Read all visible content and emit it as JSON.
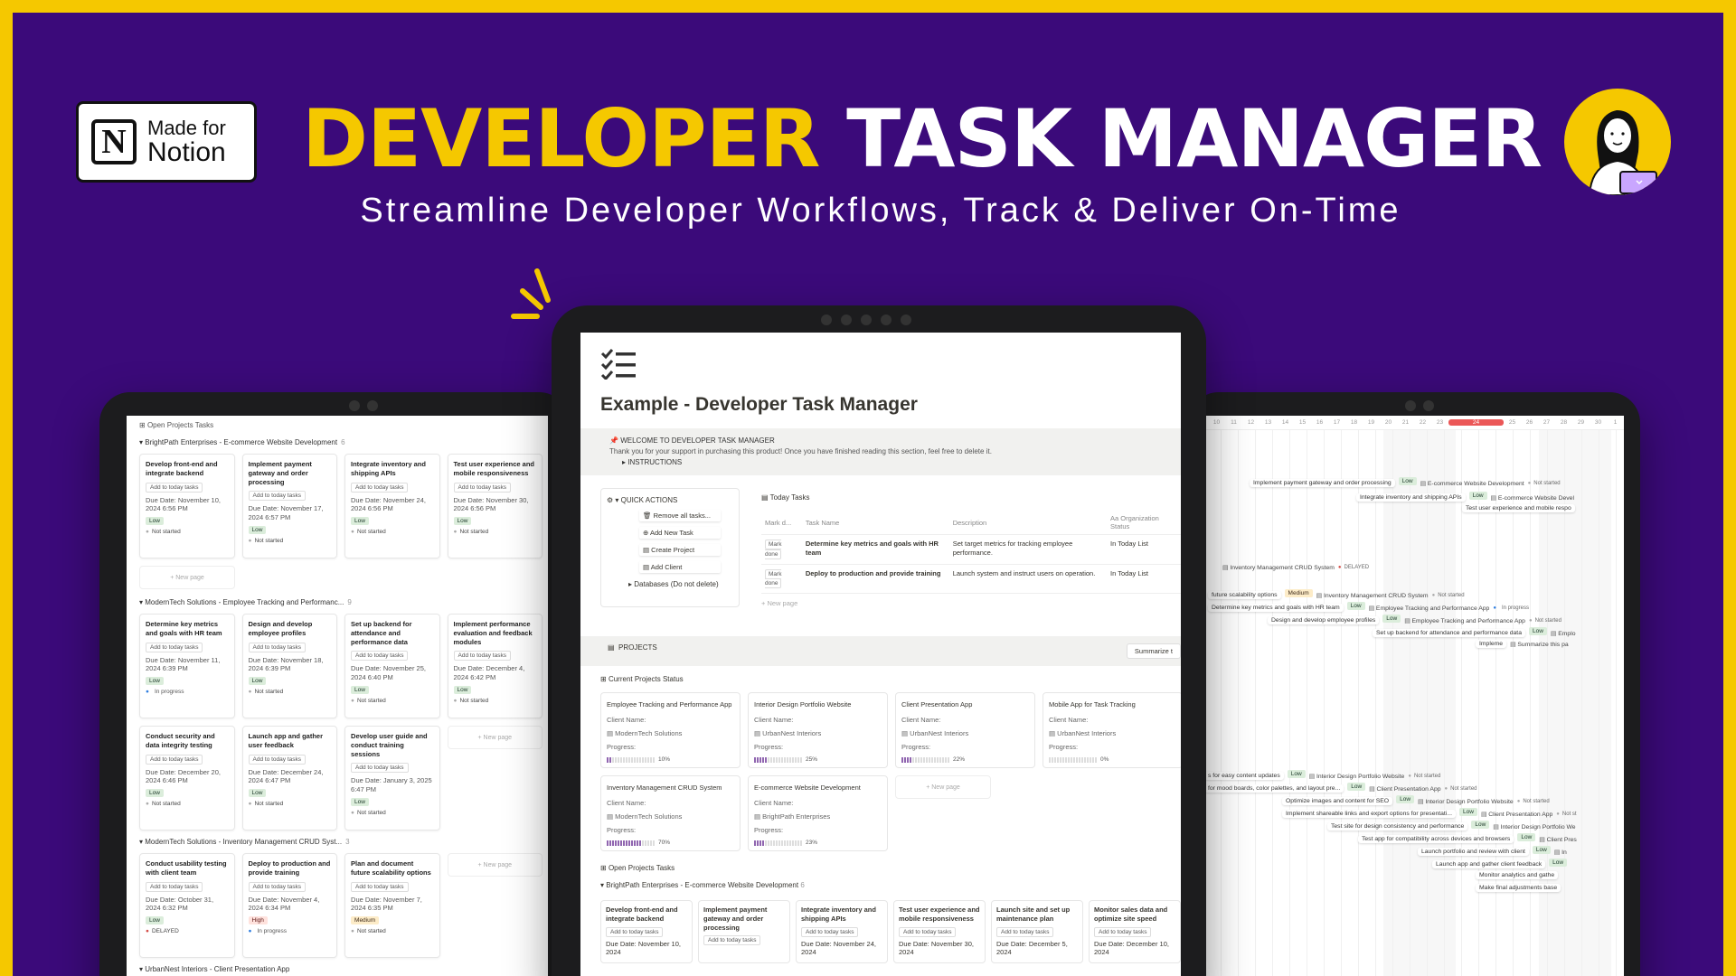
{
  "badge": {
    "line1": "Made for",
    "line2": "Notion",
    "logo_letter": "N"
  },
  "headline": {
    "part1": "DEVELOPER",
    "part2": "TASK MANAGER"
  },
  "subtitle": "Streamline Developer Workflows, Track & Deliver On-Time",
  "colors": {
    "frame": "#f5c800",
    "background": "#3b0a7a",
    "accent_yellow": "#f5c800",
    "progress_purple": "#9065b0"
  },
  "icons": [
    "notion-logo-icon",
    "avatar-illustration-icon",
    "sparkle-icon",
    "checklist-icon",
    "pin-icon",
    "gear-icon",
    "plus-icon",
    "database-icon"
  ],
  "left_board": {
    "top_title": "Open Projects Tasks",
    "groups": [
      {
        "title": "BrightPath Enterprises - E-commerce Website Development",
        "count": "6",
        "cards": [
          {
            "title": "Develop front-end and integrate backend",
            "button": "Add to today tasks",
            "due": "Due Date: November 10, 2024 6:56 PM",
            "priority": "Low",
            "status": "Not started"
          },
          {
            "title": "Implement payment gateway and order processing",
            "button": "Add to today tasks",
            "due": "Due Date: November 17, 2024 6:57 PM",
            "priority": "Low",
            "status": "Not started"
          },
          {
            "title": "Integrate inventory and shipping APIs",
            "button": "Add to today tasks",
            "due": "Due Date: November 24, 2024 6:56 PM",
            "priority": "Low",
            "status": "Not started"
          },
          {
            "title": "Test user experience and mobile responsiveness",
            "button": "Add to today tasks",
            "due": "Due Date: November 30, 2024 6:56 PM",
            "priority": "Low",
            "status": "Not started"
          }
        ],
        "new_page": "+ New page"
      },
      {
        "title": "ModernTech Solutions - Employee Tracking and Performanc...",
        "count": "9",
        "cards": [
          {
            "title": "Determine key metrics and goals with HR team",
            "button": "Add to today tasks",
            "due": "Due Date: November 11, 2024 6:39 PM",
            "priority": "Low",
            "status": "In progress"
          },
          {
            "title": "Design and develop employee profiles",
            "button": "Add to today tasks",
            "due": "Due Date: November 18, 2024 6:39 PM",
            "priority": "Low",
            "status": "Not started"
          },
          {
            "title": "Set up backend for attendance and performance data",
            "button": "Add to today tasks",
            "due": "Due Date: November 25, 2024 6:40 PM",
            "priority": "Low",
            "status": "Not started"
          },
          {
            "title": "Implement performance evaluation and feedback modules",
            "button": "Add to today tasks",
            "due": "Due Date: December 4, 2024 6:42 PM",
            "priority": "Low",
            "status": "Not started"
          }
        ],
        "cards2": [
          {
            "title": "Conduct security and data integrity testing",
            "button": "Add to today tasks",
            "due": "Due Date: December 20, 2024 6:46 PM",
            "priority": "Low",
            "status": "Not started"
          },
          {
            "title": "Launch app and gather user feedback",
            "button": "Add to today tasks",
            "due": "Due Date: December 24, 2024 6:47 PM",
            "priority": "Low",
            "status": "Not started"
          },
          {
            "title": "Develop user guide and conduct training sessions",
            "button": "Add to today tasks",
            "due": "Due Date: January 3, 2025 6:47 PM",
            "priority": "Low",
            "status": "Not started"
          }
        ],
        "new_page": "+ New page"
      },
      {
        "title": "ModernTech Solutions - Inventory Management CRUD Syst...",
        "count": "3",
        "cards": [
          {
            "title": "Conduct usability testing with client team",
            "button": "Add to today tasks",
            "due": "Due Date: October 31, 2024 6:32 PM",
            "priority": "Low",
            "status": "DELAYED"
          },
          {
            "title": "Deploy to production and provide training",
            "button": "Add to today tasks",
            "due": "Due Date: November 4, 2024 6:34 PM",
            "priority": "High",
            "status": "In progress"
          },
          {
            "title": "Plan and document future scalability options",
            "button": "Add to today tasks",
            "due": "Due Date: November 7, 2024 6:35 PM",
            "priority": "Medium",
            "status": "Not started"
          }
        ],
        "new_page": "+ New page"
      }
    ],
    "bottom_group": "UrbanNest Interiors - Client Presentation App"
  },
  "center": {
    "title": "Example - Developer Task Manager",
    "callout": {
      "title": "WELCOME TO DEVELOPER TASK MANAGER",
      "text": "Thank you for your support in purchasing this product! Once you have finished reading this section, feel free to delete it.",
      "toggle": "INSTRUCTIONS"
    },
    "quick_actions": {
      "title": "QUICK ACTIONS",
      "buttons": [
        "Remove all tasks...",
        "Add New Task",
        "Create Project",
        "Add Client"
      ],
      "databases": "Databases (Do not delete)"
    },
    "today": {
      "title": "Today Tasks",
      "columns": [
        "Mark d...",
        "Task Name",
        "Description",
        "Aa Organization Status"
      ],
      "rows": [
        {
          "mark": "Mark done",
          "task": "Determine key metrics and goals with HR team",
          "desc": "Set target metrics for tracking employee performance.",
          "org": "In Today List"
        },
        {
          "mark": "Mark done",
          "task": "Deploy to production and provide training",
          "desc": "Launch system and instruct users on operation.",
          "org": "In Today List"
        }
      ],
      "new_page": "+ New page"
    },
    "projects": {
      "title": "PROJECTS",
      "summarize": "Summarize t",
      "view_title": "Current Projects Status",
      "client_label": "Client Name:",
      "progress_label": "Progress:",
      "cards": [
        {
          "name": "Employee Tracking and Performance App",
          "client": "ModernTech Solutions",
          "progress_text": "10%",
          "progress": 0.1
        },
        {
          "name": "Interior Design Portfolio Website",
          "client": "UrbanNest Interiors",
          "progress_text": "25%",
          "progress": 0.25
        },
        {
          "name": "Client Presentation App",
          "client": "UrbanNest Interiors",
          "progress_text": "22%",
          "progress": 0.22
        },
        {
          "name": "Mobile App for Task Tracking",
          "client": "UrbanNest Interiors",
          "progress_text": "0%",
          "progress": 0.0
        },
        {
          "name": "Inventory Management CRUD System",
          "client": "ModernTech Solutions",
          "progress_text": "70%",
          "progress": 0.7
        },
        {
          "name": "E-commerce Website Development",
          "client": "BrightPath Enterprises",
          "progress_text": "23%",
          "progress": 0.23
        }
      ],
      "new_page": "+ New page"
    },
    "open_tasks": {
      "title": "Open Projects Tasks",
      "group": "BrightPath Enterprises - E-commerce Website Development",
      "count": "6",
      "cards": [
        {
          "title": "Develop front-end and integrate backend",
          "button": "Add to today tasks",
          "due": "Due Date: November 10, 2024"
        },
        {
          "title": "Implement payment gateway and order processing",
          "button": "Add to today tasks",
          "due": ""
        },
        {
          "title": "Integrate inventory and shipping APIs",
          "button": "Add to today tasks",
          "due": "Due Date: November 24, 2024"
        },
        {
          "title": "Test user experience and mobile responsiveness",
          "button": "Add to today tasks",
          "due": "Due Date: November 30, 2024"
        },
        {
          "title": "Launch site and set up maintenance plan",
          "button": "Add to today tasks",
          "due": "Due Date: December 5, 2024"
        },
        {
          "title": "Monitor sales data and optimize site speed",
          "button": "Add to today tasks",
          "due": "Due Date: December 10, 2024"
        }
      ]
    }
  },
  "right_timeline": {
    "days": [
      "10",
      "11",
      "12",
      "13",
      "14",
      "15",
      "16",
      "17",
      "18",
      "19",
      "20",
      "21",
      "22",
      "23",
      "24",
      "25",
      "26",
      "27",
      "28",
      "29",
      "30",
      "1"
    ],
    "today": "24",
    "items": [
      {
        "task": "Implement payment gateway and order processing",
        "priority": "Low",
        "db": "E-commerce Website Development",
        "status": "Not started"
      },
      {
        "task": "Integrate inventory and shipping APIs",
        "priority": "Low",
        "db": "E-commerce Website Devel",
        "status": ""
      },
      {
        "task": "Test user experience and mobile respo",
        "priority": "",
        "db": "",
        "status": ""
      },
      {
        "task": "",
        "priority": "",
        "db": "Inventory Management CRUD System",
        "status": "DELAYED"
      },
      {
        "task": "future scalability options",
        "priority": "Medium",
        "db": "Inventory Management CRUD System",
        "status": "Not started"
      },
      {
        "task": "Determine key metrics and goals with HR team",
        "priority": "Low",
        "db": "Employee Tracking and Performance App",
        "status": "In progress"
      },
      {
        "task": "Design and develop employee profiles",
        "priority": "Low",
        "db": "Employee Tracking and Performance App",
        "status": "Not started"
      },
      {
        "task": "Set up backend for attendance and performance data",
        "priority": "Low",
        "db": "Emplo",
        "status": ""
      },
      {
        "task": "Impleme",
        "priority": "",
        "db": "Summarize this pa",
        "status": ""
      },
      {
        "task": "s for easy content updates",
        "priority": "Low",
        "db": "Interior Design Portfolio Website",
        "status": "Not started"
      },
      {
        "task": "for mood boards, color palettes, and layout pre...",
        "priority": "Low",
        "db": "Client Presentation App",
        "status": "Not started"
      },
      {
        "task": "Optimize images and content for SEO",
        "priority": "Low",
        "db": "Interior Design Portfolio Website",
        "status": "Not started"
      },
      {
        "task": "Implement shareable links and export options for presentati...",
        "priority": "Low",
        "db": "Client Presentation App",
        "status": "Not st"
      },
      {
        "task": "Test site for design consistency and performance",
        "priority": "Low",
        "db": "Interior Design Portfolio We",
        "status": ""
      },
      {
        "task": "Test app for compatibility across devices and browsers",
        "priority": "Low",
        "db": "Client Pres",
        "status": ""
      },
      {
        "task": "Launch portfolio and review with client",
        "priority": "Low",
        "db": "In",
        "status": ""
      },
      {
        "task": "Launch app and gather client feedback",
        "priority": "Low",
        "db": "",
        "status": ""
      },
      {
        "task": "Monitor analytics and gathe",
        "priority": "",
        "db": "",
        "status": ""
      },
      {
        "task": "Make final adjustments base",
        "priority": "",
        "db": "",
        "status": ""
      }
    ]
  }
}
